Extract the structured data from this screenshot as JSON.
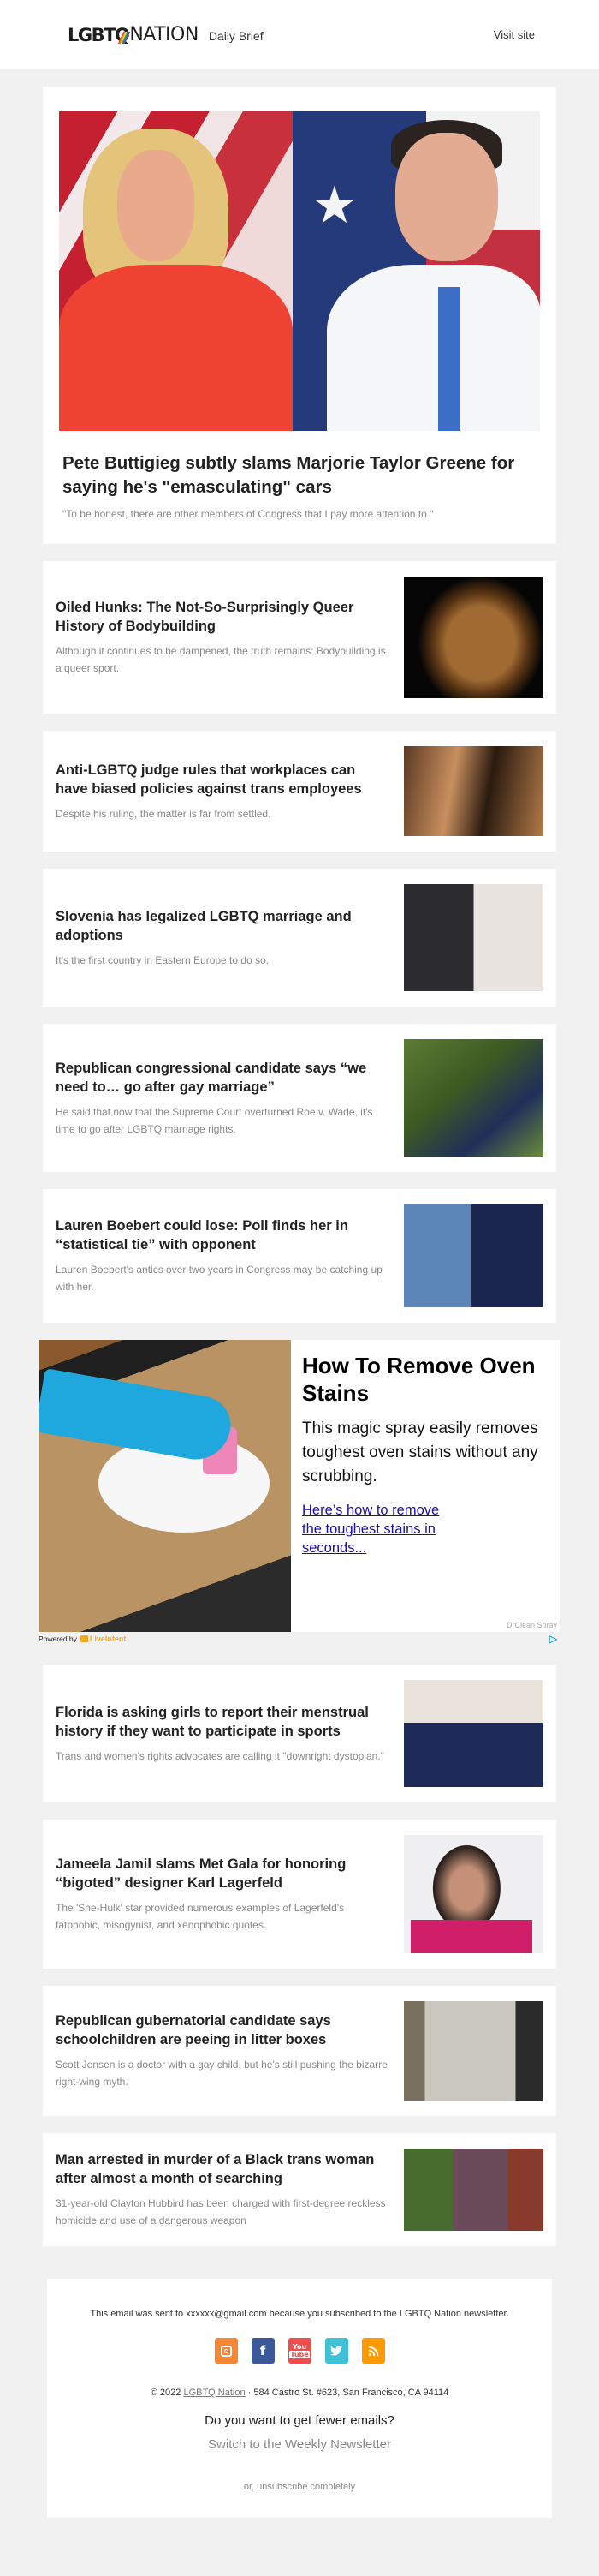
{
  "header": {
    "logo_bold": "LGBTQ",
    "logo_light": "NATION",
    "subtitle": "Daily Brief",
    "visit_site": "Visit site"
  },
  "hero": {
    "title": "Pete Buttigieg subtly slams Marjorie Taylor Greene for saying he's \"emasculating\" cars",
    "description": "\"To be honest, there are other members of Congress that I pay more attention to.\""
  },
  "stories_before_ad": [
    {
      "title": "Oiled Hunks: The Not-So-Surprisingly Queer History of Bodybuilding",
      "description": "Although it continues to be dampened, the truth remains: Bodybuilding is a queer sport."
    },
    {
      "title": "Anti-LGBTQ judge rules that workplaces can have biased policies against trans employees",
      "description": "Despite his ruling, the matter is far from settled."
    },
    {
      "title": "Slovenia has legalized LGBTQ marriage and adoptions",
      "description": "It's the first country in Eastern Europe to do so."
    },
    {
      "title": "Republican congressional candidate says “we need to… go after gay marriage”",
      "description": "He said that now that the Supreme Court overturned Roe v. Wade, it's time to go after LGBTQ marriage rights."
    },
    {
      "title": "Lauren Boebert could lose: Poll finds her in “statistical tie” with opponent",
      "description": "Lauren Boebert's antics over two years in Congress may be catching up with her."
    }
  ],
  "ad": {
    "title": "How To Remove Oven Stains",
    "body": "This magic spray easily removes toughest oven stains without any scrubbing.",
    "link": "Here’s how to remove the toughest stains in seconds...",
    "sponsor": "DrClean Spray",
    "powered_by": "Powered by",
    "provider": "LiveIntent"
  },
  "stories_after_ad": [
    {
      "title": "Florida is asking girls to report their menstrual history if they want to participate in sports",
      "description": "Trans and women's rights advocates are calling it \"downright dystopian.\""
    },
    {
      "title": "Jameela Jamil slams Met Gala for honoring “bigoted” designer Karl Lagerfeld",
      "description": "The 'She-Hulk' star provided numerous examples of Lagerfeld's fatphobic, misogynist, and xenophobic quotes."
    },
    {
      "title": "Republican gubernatorial candidate says schoolchildren are peeing in litter boxes",
      "description": "Scott Jensen is a doctor with a gay child, but he's still pushing the bizarre right-wing myth."
    },
    {
      "title": "Man arrested in murder of a Black trans woman after almost a month of searching",
      "description": "31-year-old Clayton Hubbird has been charged with first-degree reckless homicide and use of a dangerous weapon"
    }
  ],
  "footer": {
    "sent_notice": "This email was sent to xxxxxx@gmail.com because you subscribed to the LGBTQ Nation newsletter.",
    "socials": [
      {
        "name": "instagram",
        "glyph": "◙",
        "color": "#f58634"
      },
      {
        "name": "facebook",
        "glyph": "f",
        "color": "#3b5998"
      },
      {
        "name": "youtube",
        "glyph": "You Tube",
        "color": "#ee4d4d"
      },
      {
        "name": "twitter",
        "glyph": "🐦",
        "color": "#3fc1d6"
      },
      {
        "name": "rss",
        "glyph": "◥",
        "color": "#ff9900"
      }
    ],
    "copyright_prefix": "© 2022",
    "copyright_link": "LGBTQ Nation",
    "copyright_address": "· 584 Castro St. #623, San Francisco, CA 94114",
    "fewer_emails": "Do you want to get fewer emails?",
    "switch_weekly": "Switch to the Weekly Newsletter",
    "unsubscribe": "or, unsubscribe completely"
  }
}
